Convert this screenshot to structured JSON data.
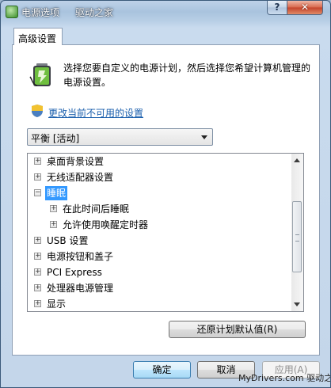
{
  "window": {
    "title": "电源选项",
    "watermark_title": "驱动之家",
    "help_label": "?",
    "close_label": "✕"
  },
  "tab": {
    "label": "高级设置"
  },
  "description": "选择您要自定义的电源计划，然后选择您希望计算机管理的电源设置。",
  "change_link": "更改当前不可用的设置",
  "plan_select": {
    "value": "平衡 [活动]"
  },
  "tree": {
    "items": [
      {
        "label": "桌面背景设置",
        "expander": "+"
      },
      {
        "label": "无线适配器设置",
        "expander": "+"
      },
      {
        "label": "睡眠",
        "expander": "−"
      },
      {
        "label": "在此时间后睡眠",
        "expander": "+"
      },
      {
        "label": "允许使用唤醒定时器",
        "expander": "+"
      },
      {
        "label": "USB 设置",
        "expander": "+"
      },
      {
        "label": "电源按钮和盖子",
        "expander": "+"
      },
      {
        "label": "PCI Express",
        "expander": "+"
      },
      {
        "label": "处理器电源管理",
        "expander": "+"
      },
      {
        "label": "显示",
        "expander": "+"
      }
    ]
  },
  "buttons": {
    "restore": "还原计划默认值(R)",
    "ok": "确定",
    "cancel": "取消",
    "apply": "应用(A)"
  },
  "watermark_bottom": "MyDrivers.com 驱动之家"
}
